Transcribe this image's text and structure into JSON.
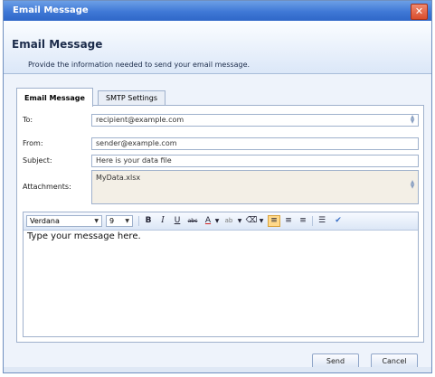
{
  "window": {
    "title": "Email Message",
    "close_glyph": "✕"
  },
  "header": {
    "title": "Email Message",
    "description": "Provide the information needed to send your email message."
  },
  "tabs": [
    {
      "label": "Email Message",
      "active": true
    },
    {
      "label": "SMTP Settings",
      "active": false
    }
  ],
  "fields": {
    "to": {
      "label": "To:",
      "value": "recipient@example.com"
    },
    "from": {
      "label": "From:",
      "value": "sender@example.com"
    },
    "subject": {
      "label": "Subject:",
      "value": "Here is your data file"
    },
    "attachments": {
      "label": "Attachments:",
      "value": "MyData.xlsx"
    }
  },
  "toolbar": {
    "font": "Verdana",
    "size": "9",
    "bold": "B",
    "italic": "I",
    "underline": "U",
    "strike": "abc",
    "font_color": "A",
    "highlight": "ab",
    "eraser": "⌫"
  },
  "editor": {
    "body": "Type your message here."
  },
  "buttons": {
    "send": "Send",
    "cancel": "Cancel"
  },
  "colors": {
    "title_bar": "#3f78d6",
    "active_align": "#ffd98a",
    "close": "#d94c2c"
  }
}
